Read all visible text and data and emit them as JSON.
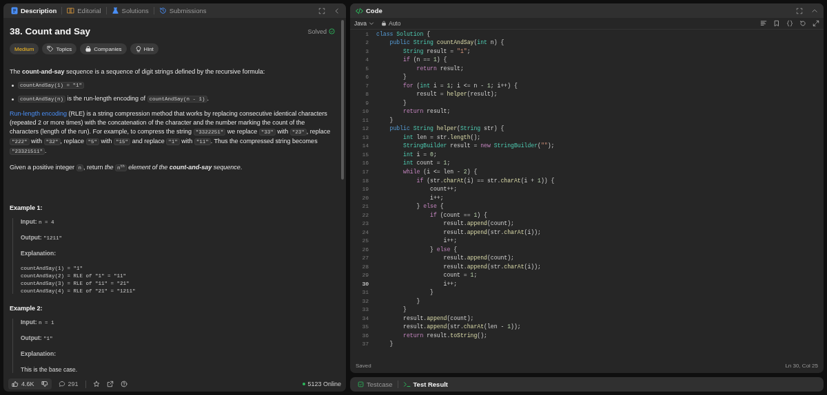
{
  "description_panel": {
    "tabs": [
      {
        "label": "Description",
        "selected": true
      },
      {
        "label": "Editorial",
        "selected": false
      },
      {
        "label": "Solutions",
        "selected": false
      },
      {
        "label": "Submissions",
        "selected": false
      }
    ],
    "title": "38. Count and Say",
    "status": "Solved",
    "tags": [
      {
        "kind": "difficulty",
        "label": "Medium"
      },
      {
        "kind": "topics",
        "label": "Topics"
      },
      {
        "kind": "companies",
        "label": "Companies"
      },
      {
        "kind": "hint",
        "label": "Hint"
      }
    ],
    "blocks": [
      {
        "kind": "paragraph",
        "segments": [
          {
            "kind": "text",
            "text": "The "
          },
          {
            "kind": "bold",
            "text": "count-and-say"
          },
          {
            "kind": "text",
            "text": " sequence is a sequence of digit strings defined by the recursive formula:"
          }
        ]
      },
      {
        "kind": "bullet",
        "segments": [
          {
            "kind": "code",
            "text": "countAndSay(1) = \"1\""
          }
        ]
      },
      {
        "kind": "bullet",
        "segments": [
          {
            "kind": "code",
            "text": "countAndSay(n)"
          },
          {
            "kind": "text",
            "text": " is the run-length encoding of "
          },
          {
            "kind": "code",
            "text": "countAndSay(n - 1)"
          },
          {
            "kind": "text",
            "text": "."
          }
        ]
      },
      {
        "kind": "paragraph",
        "segments": [
          {
            "kind": "link",
            "text": "Run-length encoding"
          },
          {
            "kind": "text",
            "text": " (RLE) is a string compression method that works by replacing consecutive identical characters (repeated 2 or more times) with the concatenation of the character and the number marking the count of the characters (length of the run). For example, to compress the string "
          },
          {
            "kind": "code",
            "text": "\"3322251\""
          },
          {
            "kind": "text",
            "text": " we replace "
          },
          {
            "kind": "code",
            "text": "\"33\""
          },
          {
            "kind": "text",
            "text": " with "
          },
          {
            "kind": "code",
            "text": "\"23\""
          },
          {
            "kind": "text",
            "text": ", replace "
          },
          {
            "kind": "code",
            "text": "\"222\""
          },
          {
            "kind": "text",
            "text": " with "
          },
          {
            "kind": "code",
            "text": "\"32\""
          },
          {
            "kind": "text",
            "text": ", replace "
          },
          {
            "kind": "code",
            "text": "\"5\""
          },
          {
            "kind": "text",
            "text": " with "
          },
          {
            "kind": "code",
            "text": "\"15\""
          },
          {
            "kind": "text",
            "text": " and replace "
          },
          {
            "kind": "code",
            "text": "\"1\""
          },
          {
            "kind": "text",
            "text": " with "
          },
          {
            "kind": "code",
            "text": "\"11\""
          },
          {
            "kind": "text",
            "text": ". Thus the compressed string becomes "
          },
          {
            "kind": "code",
            "text": "\"23321511\""
          },
          {
            "kind": "text",
            "text": "."
          }
        ]
      },
      {
        "kind": "paragraph",
        "segments": [
          {
            "kind": "text",
            "text": "Given a positive integer "
          },
          {
            "kind": "code",
            "text": "n"
          },
          {
            "kind": "text",
            "text": ", return "
          },
          {
            "kind": "italic",
            "text": "the "
          },
          {
            "kind": "code",
            "text": "n$^{th}$"
          },
          {
            "kind": "italic",
            "text": " element of the "
          },
          {
            "kind": "bold_italic",
            "text": "count-and-say"
          },
          {
            "kind": "italic",
            "text": " sequence"
          },
          {
            "kind": "text",
            "text": "."
          }
        ]
      }
    ],
    "examples": [
      {
        "heading": "Example 1:",
        "input_label": "Input:",
        "input": "n = 4",
        "output_label": "Output:",
        "output": "\"1211\"",
        "explanation_label": "Explanation:",
        "explanation": [
          {
            "kind": "code",
            "text": "countAndSay(1) = \"1\""
          },
          {
            "kind": "code",
            "text": "countAndSay(2) = RLE of \"1\" = \"11\""
          },
          {
            "kind": "code",
            "text": "countAndSay(3) = RLE of \"11\" = \"21\""
          },
          {
            "kind": "code",
            "text": "countAndSay(4) = RLE of \"21\" = \"1211\""
          }
        ]
      },
      {
        "heading": "Example 2:",
        "input_label": "Input:",
        "input": "n = 1",
        "output_label": "Output:",
        "output": "\"1\"",
        "explanation_label": "Explanation:",
        "explanation": [
          {
            "kind": "text",
            "text": "This is the base case."
          }
        ]
      }
    ],
    "footer": {
      "likes": "4.6K",
      "comments": "291",
      "online": "5123 Online"
    }
  },
  "code_panel": {
    "title": "Code",
    "language": "Java",
    "mode": "Auto",
    "status": "Saved",
    "cursor": "Ln 30, Col 25",
    "lines": [
      {
        "n": "1",
        "active": false,
        "t": [
          {
            "kind": "d",
            "text": "class"
          },
          {
            "kind": "t",
            "text": " Solution"
          },
          {
            "kind": "p",
            "text": " {"
          }
        ]
      },
      {
        "n": "2",
        "active": false,
        "t": [
          {
            "kind": "d",
            "text": "    public"
          },
          {
            "kind": "t",
            "text": " String"
          },
          {
            "kind": "f",
            "text": " countAndSay"
          },
          {
            "kind": "p",
            "text": "("
          },
          {
            "kind": "t",
            "text": "int"
          },
          {
            "kind": "p",
            "text": " n) {"
          }
        ]
      },
      {
        "n": "3",
        "active": false,
        "t": [
          {
            "kind": "t",
            "text": "        String"
          },
          {
            "kind": "p",
            "text": " result = "
          },
          {
            "kind": "s",
            "text": "\"1\""
          },
          {
            "kind": "p",
            "text": ";"
          }
        ]
      },
      {
        "n": "4",
        "active": false,
        "t": [
          {
            "kind": "k",
            "text": "        if"
          },
          {
            "kind": "p",
            "text": " (n == "
          },
          {
            "kind": "n",
            "text": "1"
          },
          {
            "kind": "p",
            "text": ") {"
          }
        ]
      },
      {
        "n": "5",
        "active": false,
        "t": [
          {
            "kind": "k",
            "text": "            return"
          },
          {
            "kind": "p",
            "text": " result;"
          }
        ]
      },
      {
        "n": "6",
        "active": false,
        "t": [
          {
            "kind": "p",
            "text": "        }"
          }
        ]
      },
      {
        "n": "7",
        "active": false,
        "t": [
          {
            "kind": "k",
            "text": "        for"
          },
          {
            "kind": "p",
            "text": " ("
          },
          {
            "kind": "t",
            "text": "int"
          },
          {
            "kind": "p",
            "text": " i = "
          },
          {
            "kind": "n",
            "text": "1"
          },
          {
            "kind": "p",
            "text": "; i <= n - "
          },
          {
            "kind": "n",
            "text": "1"
          },
          {
            "kind": "p",
            "text": "; i++) {"
          }
        ]
      },
      {
        "n": "8",
        "active": false,
        "t": [
          {
            "kind": "p",
            "text": "            result = "
          },
          {
            "kind": "f",
            "text": "helper"
          },
          {
            "kind": "p",
            "text": "(result);"
          }
        ]
      },
      {
        "n": "9",
        "active": false,
        "t": [
          {
            "kind": "p",
            "text": "        }"
          }
        ]
      },
      {
        "n": "10",
        "active": false,
        "t": [
          {
            "kind": "k",
            "text": "        return"
          },
          {
            "kind": "p",
            "text": " result;"
          }
        ]
      },
      {
        "n": "11",
        "active": false,
        "t": [
          {
            "kind": "p",
            "text": "    }"
          }
        ]
      },
      {
        "n": "12",
        "active": false,
        "t": [
          {
            "kind": "d",
            "text": "    public"
          },
          {
            "kind": "t",
            "text": " String"
          },
          {
            "kind": "f",
            "text": " helper"
          },
          {
            "kind": "p",
            "text": "("
          },
          {
            "kind": "t",
            "text": "String"
          },
          {
            "kind": "p",
            "text": " str) {"
          }
        ]
      },
      {
        "n": "13",
        "active": false,
        "t": [
          {
            "kind": "t",
            "text": "        int"
          },
          {
            "kind": "p",
            "text": " len = str."
          },
          {
            "kind": "f",
            "text": "length"
          },
          {
            "kind": "p",
            "text": "();"
          }
        ]
      },
      {
        "n": "14",
        "active": false,
        "t": [
          {
            "kind": "t",
            "text": "        StringBuilder"
          },
          {
            "kind": "p",
            "text": " result = "
          },
          {
            "kind": "k",
            "text": "new"
          },
          {
            "kind": "t",
            "text": " StringBuilder"
          },
          {
            "kind": "p",
            "text": "("
          },
          {
            "kind": "s",
            "text": "\"\""
          },
          {
            "kind": "p",
            "text": ");"
          }
        ]
      },
      {
        "n": "15",
        "active": false,
        "t": [
          {
            "kind": "t",
            "text": "        int"
          },
          {
            "kind": "p",
            "text": " i = "
          },
          {
            "kind": "n",
            "text": "0"
          },
          {
            "kind": "p",
            "text": ";"
          }
        ]
      },
      {
        "n": "16",
        "active": false,
        "t": [
          {
            "kind": "t",
            "text": "        int"
          },
          {
            "kind": "p",
            "text": " count = "
          },
          {
            "kind": "n",
            "text": "1"
          },
          {
            "kind": "p",
            "text": ";"
          }
        ]
      },
      {
        "n": "17",
        "active": false,
        "t": [
          {
            "kind": "k",
            "text": "        while"
          },
          {
            "kind": "p",
            "text": " (i <= len - "
          },
          {
            "kind": "n",
            "text": "2"
          },
          {
            "kind": "p",
            "text": ") {"
          }
        ]
      },
      {
        "n": "18",
        "active": false,
        "t": [
          {
            "kind": "k",
            "text": "            if"
          },
          {
            "kind": "p",
            "text": " (str."
          },
          {
            "kind": "f",
            "text": "charAt"
          },
          {
            "kind": "p",
            "text": "(i) == str."
          },
          {
            "kind": "f",
            "text": "charAt"
          },
          {
            "kind": "p",
            "text": "(i + "
          },
          {
            "kind": "n",
            "text": "1"
          },
          {
            "kind": "p",
            "text": ")) {"
          }
        ]
      },
      {
        "n": "19",
        "active": false,
        "t": [
          {
            "kind": "p",
            "text": "                count++;"
          }
        ]
      },
      {
        "n": "20",
        "active": false,
        "t": [
          {
            "kind": "p",
            "text": "                i++;"
          }
        ]
      },
      {
        "n": "21",
        "active": false,
        "t": [
          {
            "kind": "p",
            "text": "            } "
          },
          {
            "kind": "k",
            "text": "else"
          },
          {
            "kind": "p",
            "text": " {"
          }
        ]
      },
      {
        "n": "22",
        "active": false,
        "t": [
          {
            "kind": "k",
            "text": "                if"
          },
          {
            "kind": "p",
            "text": " (count == "
          },
          {
            "kind": "n",
            "text": "1"
          },
          {
            "kind": "p",
            "text": ") {"
          }
        ]
      },
      {
        "n": "23",
        "active": false,
        "t": [
          {
            "kind": "p",
            "text": "                    result."
          },
          {
            "kind": "f",
            "text": "append"
          },
          {
            "kind": "p",
            "text": "(count);"
          }
        ]
      },
      {
        "n": "24",
        "active": false,
        "t": [
          {
            "kind": "p",
            "text": "                    result."
          },
          {
            "kind": "f",
            "text": "append"
          },
          {
            "kind": "p",
            "text": "(str."
          },
          {
            "kind": "f",
            "text": "charAt"
          },
          {
            "kind": "p",
            "text": "(i));"
          }
        ]
      },
      {
        "n": "25",
        "active": false,
        "t": [
          {
            "kind": "p",
            "text": "                    i++;"
          }
        ]
      },
      {
        "n": "26",
        "active": false,
        "t": [
          {
            "kind": "p",
            "text": "                } "
          },
          {
            "kind": "k",
            "text": "else"
          },
          {
            "kind": "p",
            "text": " {"
          }
        ]
      },
      {
        "n": "27",
        "active": false,
        "t": [
          {
            "kind": "p",
            "text": "                    result."
          },
          {
            "kind": "f",
            "text": "append"
          },
          {
            "kind": "p",
            "text": "(count);"
          }
        ]
      },
      {
        "n": "28",
        "active": false,
        "t": [
          {
            "kind": "p",
            "text": "                    result."
          },
          {
            "kind": "f",
            "text": "append"
          },
          {
            "kind": "p",
            "text": "(str."
          },
          {
            "kind": "f",
            "text": "charAt"
          },
          {
            "kind": "p",
            "text": "(i));"
          }
        ]
      },
      {
        "n": "29",
        "active": false,
        "t": [
          {
            "kind": "p",
            "text": "                    count = "
          },
          {
            "kind": "n",
            "text": "1"
          },
          {
            "kind": "p",
            "text": ";"
          }
        ]
      },
      {
        "n": "30",
        "active": true,
        "t": [
          {
            "kind": "p",
            "text": "                    i++;"
          }
        ]
      },
      {
        "n": "31",
        "active": false,
        "t": [
          {
            "kind": "p",
            "text": "                }"
          }
        ]
      },
      {
        "n": "32",
        "active": false,
        "t": [
          {
            "kind": "p",
            "text": "            }"
          }
        ]
      },
      {
        "n": "33",
        "active": false,
        "t": [
          {
            "kind": "p",
            "text": "        }"
          }
        ]
      },
      {
        "n": "34",
        "active": false,
        "t": [
          {
            "kind": "p",
            "text": "        result."
          },
          {
            "kind": "f",
            "text": "append"
          },
          {
            "kind": "p",
            "text": "(count);"
          }
        ]
      },
      {
        "n": "35",
        "active": false,
        "t": [
          {
            "kind": "p",
            "text": "        result."
          },
          {
            "kind": "f",
            "text": "append"
          },
          {
            "kind": "p",
            "text": "(str."
          },
          {
            "kind": "f",
            "text": "charAt"
          },
          {
            "kind": "p",
            "text": "(len - "
          },
          {
            "kind": "n",
            "text": "1"
          },
          {
            "kind": "p",
            "text": "));"
          }
        ]
      },
      {
        "n": "36",
        "active": false,
        "t": [
          {
            "kind": "k",
            "text": "        return"
          },
          {
            "kind": "p",
            "text": " result."
          },
          {
            "kind": "f",
            "text": "toString"
          },
          {
            "kind": "p",
            "text": "();"
          }
        ]
      },
      {
        "n": "37",
        "active": false,
        "t": [
          {
            "kind": "p",
            "text": "    }"
          }
        ]
      }
    ]
  },
  "result_panel": {
    "tabs": [
      {
        "label": "Testcase",
        "selected": false
      },
      {
        "label": "Test Result",
        "selected": true
      }
    ]
  }
}
